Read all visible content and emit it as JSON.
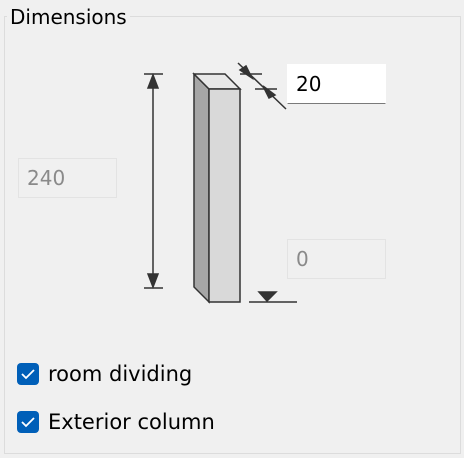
{
  "group": {
    "title": "Dimensions"
  },
  "fields": {
    "thickness": "20",
    "height": "240",
    "offset": "0"
  },
  "options": [
    {
      "label": "room dividing",
      "checked": true
    },
    {
      "label": "Exterior column",
      "checked": true
    }
  ],
  "colors": {
    "accent": "#005fb8",
    "wall_front": "#d9d9d9",
    "wall_side": "#a6a6a6",
    "stroke": "#333333"
  }
}
